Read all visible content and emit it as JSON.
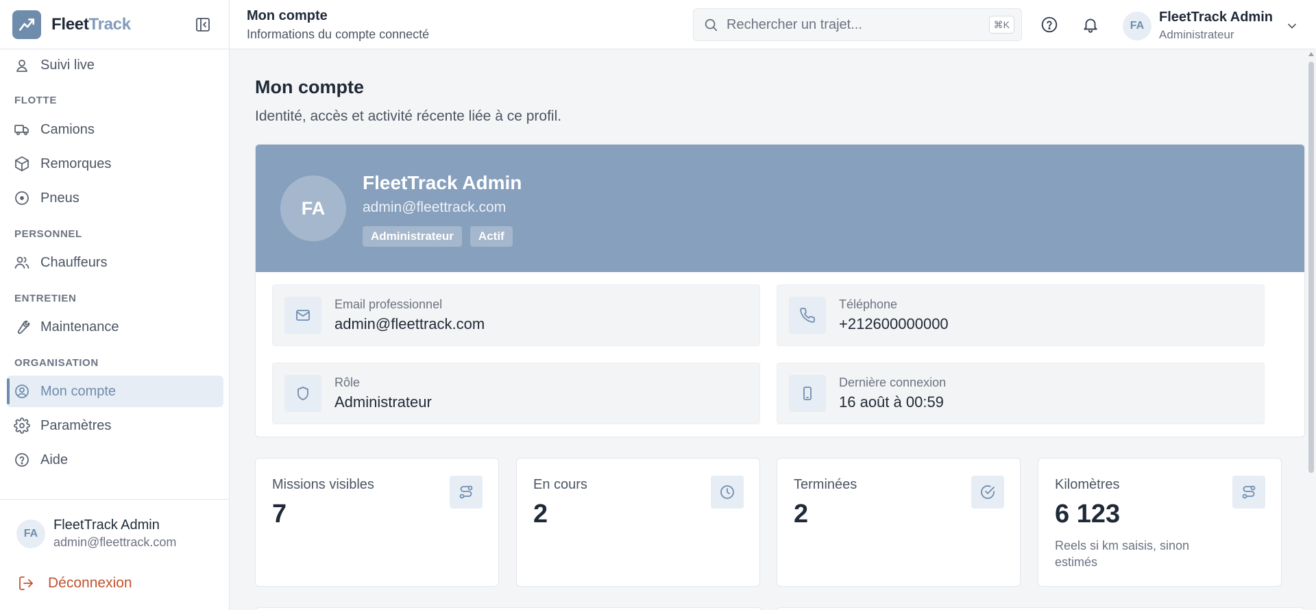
{
  "brand": {
    "name_part1": "Fleet",
    "name_part2": "Track"
  },
  "sidebar": {
    "live": {
      "label": "Suivi live"
    },
    "section_flotte": "FLOTTE",
    "camions": "Camions",
    "remorques": "Remorques",
    "pneus": "Pneus",
    "section_personnel": "PERSONNEL",
    "chauffeurs": "Chauffeurs",
    "section_entretien": "ENTRETIEN",
    "maintenance": "Maintenance",
    "section_organisation": "ORGANISATION",
    "mon_compte": "Mon compte",
    "parametres": "Paramètres",
    "aide": "Aide",
    "user": {
      "initials": "FA",
      "name": "FleetTrack Admin",
      "email": "admin@fleettrack.com"
    },
    "logout": "Déconnexion"
  },
  "topbar": {
    "title": "Mon compte",
    "subtitle": "Informations du compte connecté",
    "search_placeholder": "Rechercher un trajet...",
    "shortcut": "⌘K",
    "user": {
      "initials": "FA",
      "name": "FleetTrack Admin",
      "role": "Administrateur"
    }
  },
  "page": {
    "title": "Mon compte",
    "subtitle": "Identité, accès et activité récente liée à ce profil."
  },
  "profile": {
    "initials": "FA",
    "name": "FleetTrack Admin",
    "email": "admin@fleettrack.com",
    "badge_role": "Administrateur",
    "badge_status": "Actif"
  },
  "info": {
    "email": {
      "label": "Email professionnel",
      "value": "admin@fleettrack.com"
    },
    "phone": {
      "label": "Téléphone",
      "value": "+212600000000"
    },
    "role": {
      "label": "Rôle",
      "value": "Administrateur"
    },
    "last_login": {
      "label": "Dernière connexion",
      "value": "16 août à 00:59"
    }
  },
  "stats": {
    "missions": {
      "label": "Missions visibles",
      "value": "7"
    },
    "en_cours": {
      "label": "En cours",
      "value": "2"
    },
    "terminees": {
      "label": "Terminées",
      "value": "2"
    },
    "km": {
      "label": "Kilomètres",
      "value": "6 123",
      "note": "Reels si km saisis, sinon estimés"
    }
  },
  "colors": {
    "accent": "#6f8cad",
    "banner": "#86a0bd",
    "logout": "#c2522f"
  }
}
